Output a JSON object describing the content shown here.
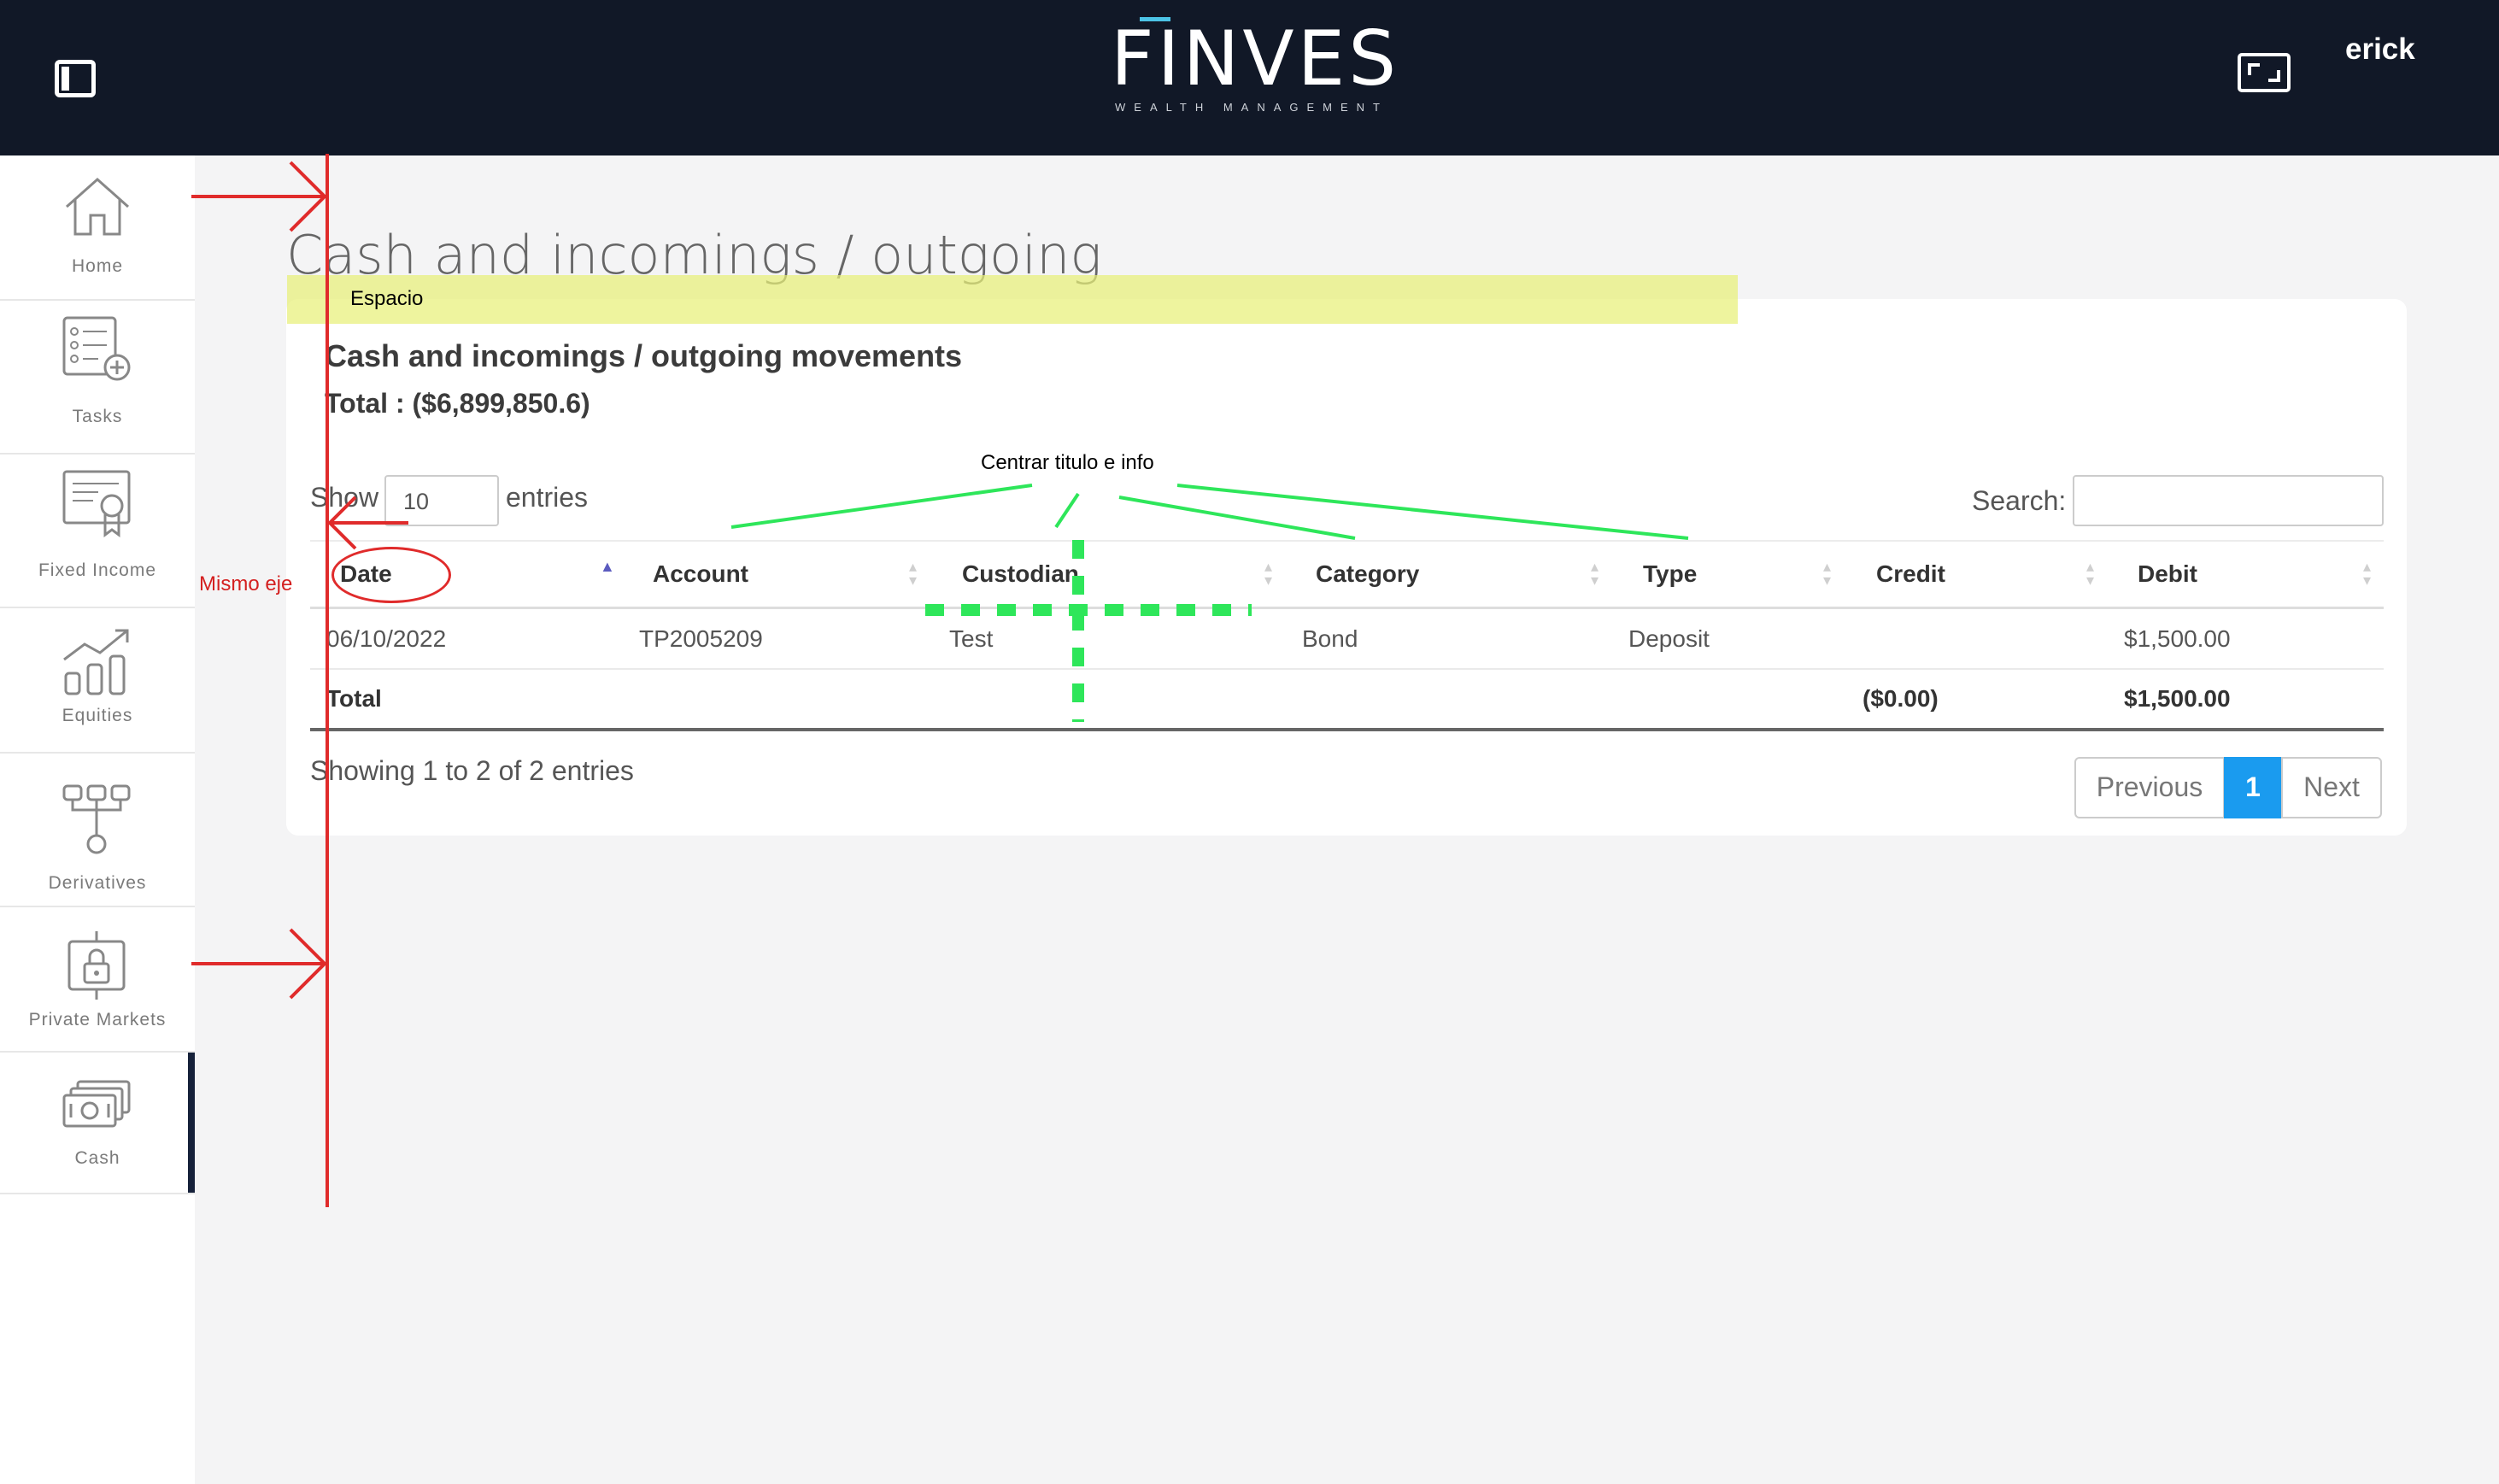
{
  "header": {
    "logo_text": "FINVES",
    "logo_subtitle": "WEALTH MANAGEMENT",
    "user": "erick"
  },
  "sidebar": {
    "items": [
      {
        "label": "Home",
        "icon": "home-icon"
      },
      {
        "label": "Tasks",
        "icon": "tasks-icon"
      },
      {
        "label": "Fixed Income",
        "icon": "certificate-icon"
      },
      {
        "label": "Equities",
        "icon": "chart-growth-icon"
      },
      {
        "label": "Derivatives",
        "icon": "hierarchy-icon"
      },
      {
        "label": "Private Markets",
        "icon": "lock-icon"
      },
      {
        "label": "Cash",
        "icon": "cash-icon"
      }
    ],
    "active": "Cash"
  },
  "page": {
    "title": "Cash and incomings / outgoing",
    "card_title": "Cash and incomings / outgoing movements",
    "total": "Total : ($6,899,850.6)"
  },
  "table_controls": {
    "show_label": "Show",
    "entries_value": "10",
    "entries_label": "entries",
    "search_label": "Search:"
  },
  "table": {
    "columns": [
      "Date",
      "Account",
      "Custodian",
      "Category",
      "Type",
      "Credit",
      "Debit"
    ],
    "rows": [
      {
        "date": "06/10/2022",
        "account": "TP2005209",
        "custodian": "Test",
        "category": "Bond",
        "type": "Deposit",
        "credit": "",
        "debit": "$1,500.00"
      }
    ],
    "footer": {
      "label": "Total",
      "credit": "($0.00)",
      "debit": "$1,500.00"
    }
  },
  "pagination": {
    "info": "Showing 1 to 2 of 2 entries",
    "previous": "Previous",
    "current": "1",
    "next": "Next"
  },
  "annotations": {
    "espacio": "Espacio",
    "mismo_eje": "Mismo eje",
    "centrar": "Centrar titulo e info"
  },
  "colors": {
    "topbar": "#111827",
    "accent": "#1a9bef",
    "annotation_red": "#e02b2b",
    "annotation_green": "#2ee65a",
    "annotation_yellow": "#e8f078"
  }
}
